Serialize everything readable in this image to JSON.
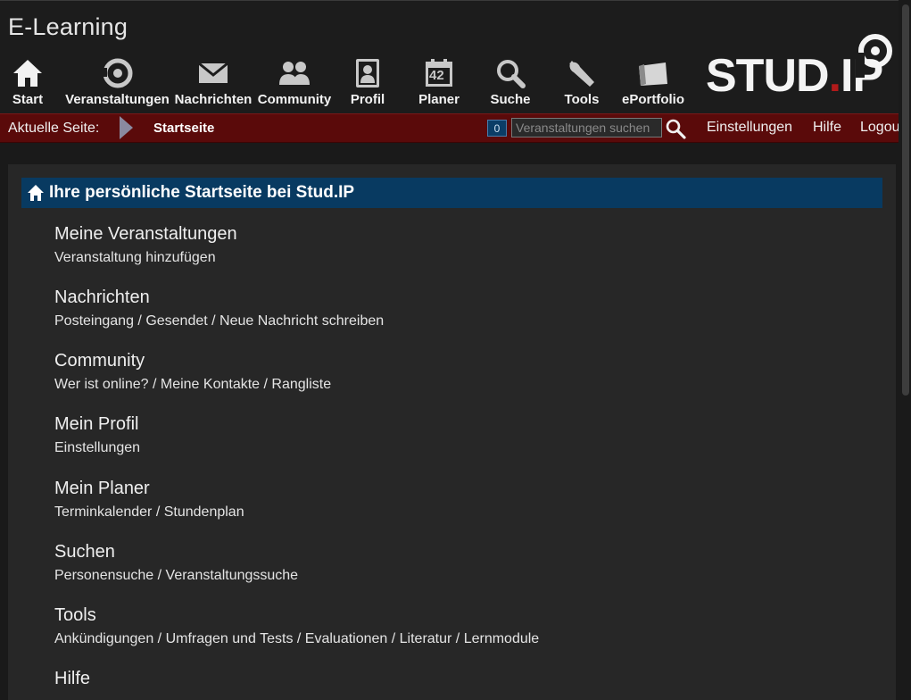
{
  "site": {
    "title": "E-Learning"
  },
  "nav": [
    {
      "label": "Start",
      "icon": "home-icon"
    },
    {
      "label": "Veranstaltungen",
      "icon": "seminar-icon"
    },
    {
      "label": "Nachrichten",
      "icon": "mail-icon"
    },
    {
      "label": "Community",
      "icon": "community-icon"
    },
    {
      "label": "Profil",
      "icon": "profile-icon"
    },
    {
      "label": "Planer",
      "icon": "calendar-icon",
      "calendar_day": "42"
    },
    {
      "label": "Suche",
      "icon": "search-icon"
    },
    {
      "label": "Tools",
      "icon": "wrench-icon"
    },
    {
      "label": "ePortfolio",
      "icon": "portfolio-icon"
    }
  ],
  "logo": {
    "text_main": "STUD",
    "text_dot": ".",
    "text_end": "IP"
  },
  "breadcrumb": {
    "label": "Aktuelle Seite:",
    "page": "Startseite"
  },
  "search": {
    "count": "0",
    "placeholder": "Veranstaltungen suchen"
  },
  "top_links": [
    "Einstellungen",
    "Hilfe",
    "Logout"
  ],
  "main": {
    "header": "Ihre persönliche Startseite bei Stud.IP",
    "sections": [
      {
        "title": "Meine Veranstaltungen",
        "links": [
          "Veranstaltung hinzufügen"
        ]
      },
      {
        "title": "Nachrichten",
        "links": [
          "Posteingang",
          "Gesendet",
          "Neue Nachricht schreiben"
        ]
      },
      {
        "title": "Community",
        "links": [
          "Wer ist online?",
          "Meine Kontakte",
          "Rangliste"
        ]
      },
      {
        "title": "Mein Profil",
        "links": [
          "Einstellungen"
        ]
      },
      {
        "title": "Mein Planer",
        "links": [
          "Terminkalender",
          "Stundenplan"
        ]
      },
      {
        "title": "Suchen",
        "links": [
          "Personensuche",
          "Veranstaltungssuche"
        ]
      },
      {
        "title": "Tools",
        "links": [
          "Ankündigungen",
          "Umfragen und Tests",
          "Evaluationen",
          "Literatur",
          "Lernmodule"
        ]
      },
      {
        "title": "Hilfe",
        "links": []
      }
    ],
    "link_separator": " / "
  },
  "colors": {
    "breadcrumb_bg": "#5a0a0a",
    "header_bg": "#083a61",
    "logo_dot": "#b11a1a"
  }
}
